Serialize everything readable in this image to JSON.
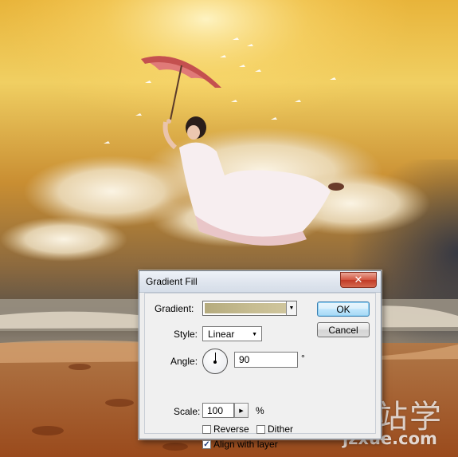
{
  "dialog": {
    "title": "Gradient Fill",
    "close_glyph": "✕",
    "ok_label": "OK",
    "cancel_label": "Cancel"
  },
  "fields": {
    "gradient_label": "Gradient:",
    "gradient_colors": [
      "#b5ab7e",
      "#cfc59c"
    ],
    "style_label": "Style:",
    "style_value": "Linear",
    "angle_label": "Angle:",
    "angle_value": "90",
    "angle_unit": "°",
    "scale_label": "Scale:",
    "scale_value": "100",
    "scale_unit": "%"
  },
  "checkboxes": {
    "reverse": {
      "label": "Reverse",
      "checked": false
    },
    "dither": {
      "label": "Dither",
      "checked": false
    },
    "align_with_layer": {
      "label": "Align with layer",
      "checked": true
    }
  },
  "watermark": {
    "chinese": "建站学",
    "url": "jzxue.com"
  },
  "icons": {
    "dropdown": "chevron-down-icon",
    "stepper": "triangle-right-icon",
    "close": "close-icon",
    "checkmark": "checkmark-icon",
    "angle_dial": "angle-dial-icon"
  }
}
